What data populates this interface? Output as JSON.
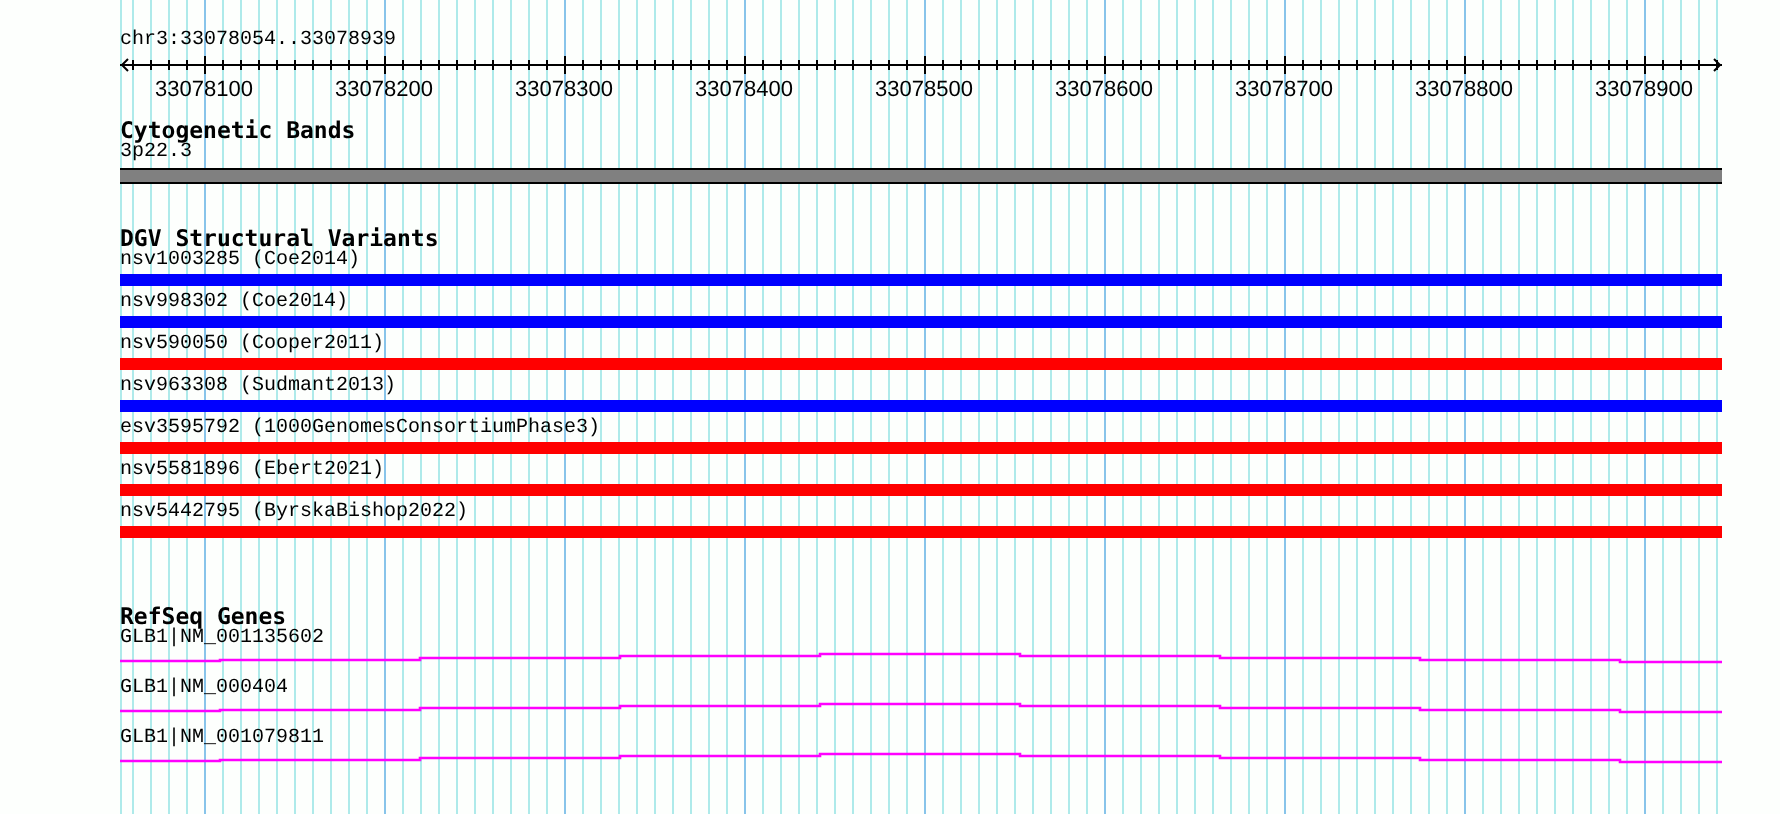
{
  "ruler": {
    "location": "chr3:33078054..33078939",
    "ticks": [
      "33078100",
      "33078200",
      "33078300",
      "33078400",
      "33078500",
      "33078600",
      "33078700",
      "33078800",
      "33078900"
    ]
  },
  "tracks": [
    {
      "kind": "cytoband",
      "title": "Cytogenetic Bands",
      "features": [
        {
          "label": "3p22.3"
        }
      ]
    },
    {
      "kind": "variants",
      "title": "DGV Structural Variants",
      "features": [
        {
          "label": "nsv1003285 (Coe2014)",
          "color": "#0000ff"
        },
        {
          "label": "nsv998302 (Coe2014)",
          "color": "#0000ff"
        },
        {
          "label": "nsv590050 (Cooper2011)",
          "color": "#ff0000"
        },
        {
          "label": "nsv963308 (Sudmant2013)",
          "color": "#0000ff"
        },
        {
          "label": "esv3595792 (1000GenomesConsortiumPhase3)",
          "color": "#ff0000"
        },
        {
          "label": "nsv5581896 (Ebert2021)",
          "color": "#ff0000"
        },
        {
          "label": "nsv5442795 (ByrskaBishop2022)",
          "color": "#ff0000"
        }
      ]
    },
    {
      "kind": "genes",
      "title": "RefSeq Genes",
      "features": [
        {
          "label": "GLB1|NM_001135602"
        },
        {
          "label": "GLB1|NM_000404"
        },
        {
          "label": "GLB1|NM_001079811"
        }
      ]
    }
  ]
}
